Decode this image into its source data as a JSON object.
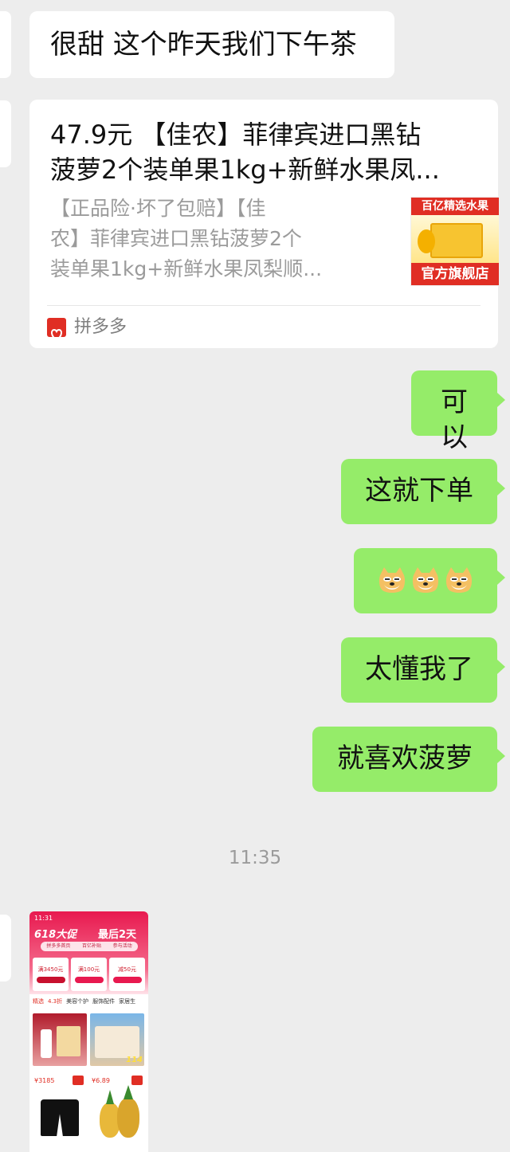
{
  "messages": {
    "m1": "很甜 这个昨天我们下午茶",
    "card": {
      "title_line1": "47.9元 【佳农】菲律宾进口黑钻",
      "title_line2": "菠萝2个装单果1kg+新鲜水果凤...",
      "desc_line1": "【正品险·坏了包赔】【佳",
      "desc_line2": "农】菲律宾进口黑钻菠萝2个",
      "desc_line3": "装单果1kg+新鲜水果凤梨顺...",
      "thumb_top": "百亿精选水果",
      "thumb_bottom": "官方旗舰店",
      "source": "拼多多"
    },
    "r1": "可以",
    "r2": "这就下单",
    "r3_emoji": "doge-emoji ×3",
    "r4": "太懂我了",
    "r5": "就喜欢菠萝"
  },
  "timestamp": "11:35",
  "screenshot": {
    "time": "11:31",
    "banner": "618大促",
    "banner2": "最后2天",
    "nav1": "拼多多首页",
    "nav2": "百亿补贴",
    "nav3": "参与活动",
    "coupon1_label": "满3450元",
    "coupon2_label": "满100元",
    "coupon3_label": "减50元",
    "tab1": "精选",
    "tab2": "4.3折",
    "tab3": "美容个护",
    "tab4": "服饰配件",
    "tab5": "家居生",
    "price1": "¥3185",
    "price2": "¥6.89",
    "badge": "114"
  },
  "colors": {
    "sent_bubble": "#95ec69",
    "received_bubble": "#ffffff",
    "background": "#ededed",
    "pdd_red": "#e02e24"
  }
}
